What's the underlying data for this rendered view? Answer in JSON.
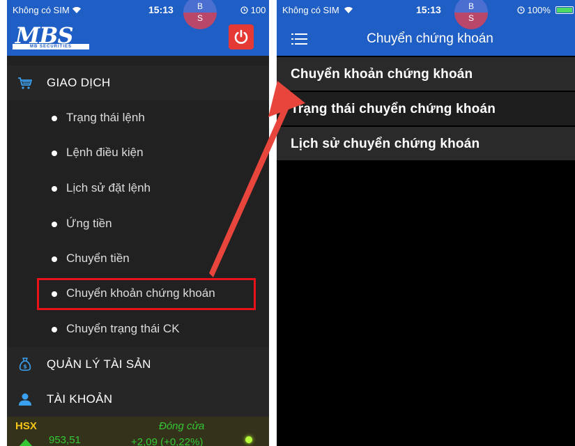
{
  "left_screen": {
    "status_bar": {
      "carrier": "Không có SIM",
      "time": "15:13",
      "battery_text": "100"
    },
    "logo": {
      "text": "MBS",
      "subtext": "MB SECURITIES"
    },
    "bs_badge": {
      "top": "B",
      "bottom": "S"
    },
    "menu": {
      "giao_dich": {
        "label": "GIAO DỊCH",
        "items": [
          {
            "label": "Trạng thái lệnh"
          },
          {
            "label": "Lệnh điều kiện"
          },
          {
            "label": "Lịch sử đặt lệnh"
          },
          {
            "label": "Ứng tiền"
          },
          {
            "label": "Chuyển tiền"
          },
          {
            "label": "Chuyển khoản chứng khoán"
          },
          {
            "label": "Chuyển trạng thái CK"
          }
        ]
      },
      "quan_ly_tai_san": {
        "label": "QUẢN LÝ TÀI SẢN"
      },
      "tai_khoan": {
        "label": "TÀI KHOẢN"
      }
    },
    "ticker": {
      "exchange": "HSX",
      "status": "Đóng cửa",
      "index": "953,51",
      "change": "+2,09 (+0,22%)"
    }
  },
  "right_screen": {
    "status_bar": {
      "carrier": "Không có SIM",
      "time": "15:13",
      "battery_text": "100%"
    },
    "bs_badge": {
      "top": "B",
      "bottom": "S"
    },
    "title": "Chuyển chứng khoán",
    "items": [
      {
        "label": "Chuyển khoản chứng khoán"
      },
      {
        "label": "Trạng thái chuyển chứng khoán"
      },
      {
        "label": "Lịch sử chuyển chứng khoán"
      }
    ]
  },
  "colors": {
    "header_blue": "#1f5ec4",
    "menu_bg": "#212121",
    "highlight_red": "#e8121b",
    "arrow_red": "#e8453c",
    "positive_green": "#35c835",
    "exchange_yellow": "#f5c518"
  }
}
